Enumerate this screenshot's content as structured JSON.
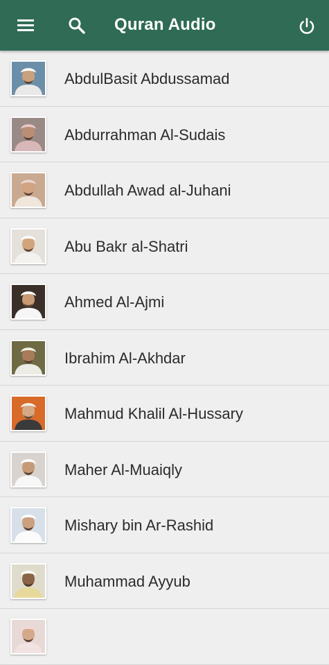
{
  "appbar": {
    "title": "Quran Audio",
    "menu_icon": "hamburger-menu-icon",
    "search_icon": "search-icon",
    "power_icon": "power-icon",
    "color": "#2f6b55"
  },
  "reciters": [
    {
      "name": "AbdulBasit Abdussamad",
      "bg": "#6b8fa8",
      "skin": "#c9a27d",
      "cloth": "#e9e9e9",
      "head": "#ffffff"
    },
    {
      "name": "Abdurrahman Al-Sudais",
      "bg": "#9a8a86",
      "skin": "#b98e73",
      "cloth": "#d8b7b9",
      "head": "#e8c8cc"
    },
    {
      "name": "Abdullah Awad al-Juhani",
      "bg": "#c9a98f",
      "skin": "#d2a482",
      "cloth": "#f0e6dc",
      "head": "#e9d5cf"
    },
    {
      "name": "Abu Bakr al-Shatri",
      "bg": "#e4e0da",
      "skin": "#d1a47c",
      "cloth": "#f4f2ee",
      "head": "#fbfbfb"
    },
    {
      "name": "Ahmed Al-Ajmi",
      "bg": "#3a2f29",
      "skin": "#c99b74",
      "cloth": "#f6f6f6",
      "head": "#ffffff"
    },
    {
      "name": "Ibrahim Al-Akhdar",
      "bg": "#6e6a44",
      "skin": "#a87c5a",
      "cloth": "#ecebe4",
      "head": "#f2f0e6"
    },
    {
      "name": "Mahmud Khalil Al-Hussary",
      "bg": "#d86a2a",
      "skin": "#d5a985",
      "cloth": "#3a3a3a",
      "head": "#f3f0e6"
    },
    {
      "name": "Maher Al-Muaiqly",
      "bg": "#d9d3cf",
      "skin": "#c69a78",
      "cloth": "#f7f7f7",
      "head": "#ffffff"
    },
    {
      "name": "Mishary bin Ar-Rashid",
      "bg": "#d7dfe8",
      "skin": "#caa07f",
      "cloth": "#fbfbfb",
      "head": "#ffffff"
    },
    {
      "name": "Muhammad Ayyub",
      "bg": "#e0dccd",
      "skin": "#8a6448",
      "cloth": "#e7d99a",
      "head": "#ffffff"
    },
    {
      "name": "",
      "bg": "#e7d9d6",
      "skin": "#d4a88a",
      "cloth": "#f2e3e3",
      "head": "#f3d7d7"
    }
  ]
}
